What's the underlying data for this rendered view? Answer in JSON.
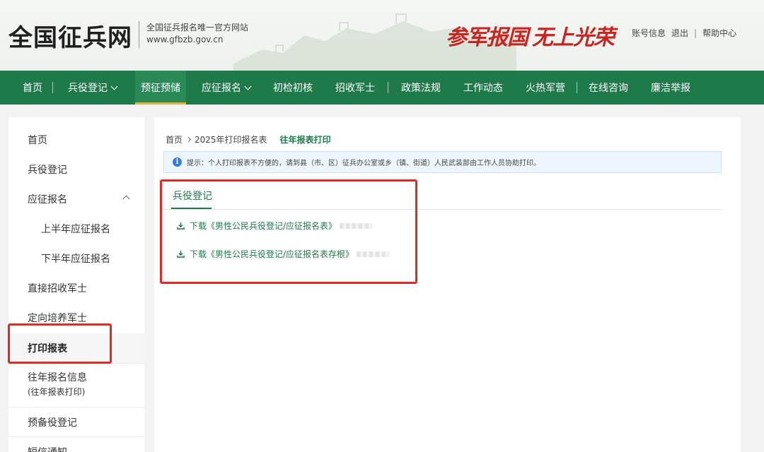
{
  "header": {
    "site_title": "全国征兵网",
    "subtitle": "全国征兵报名唯一官方网站",
    "domain": "www.gfbzb.gov.cn",
    "slogan_1": "参军报国",
    "slogan_2": "无上光荣",
    "links": {
      "account": "账号信息",
      "logout": "退出",
      "sep": "|",
      "help": "帮助中心"
    }
  },
  "nav": {
    "items": [
      {
        "label": "首页"
      },
      {
        "label": "兵役登记"
      },
      {
        "label": "预征预储"
      },
      {
        "label": "应征报名"
      },
      {
        "label": "初检初核"
      },
      {
        "label": "招收军士"
      },
      {
        "label": "政策法规"
      },
      {
        "label": "工作动态"
      },
      {
        "label": "火热军营"
      },
      {
        "label": "在线咨询"
      },
      {
        "label": "廉洁举报"
      }
    ],
    "active": "预征预储"
  },
  "sidebar": {
    "items": [
      {
        "label": "首页"
      },
      {
        "label": "兵役登记"
      },
      {
        "label": "应征报名"
      },
      {
        "label": "上半年应征报名"
      },
      {
        "label": "下半年应征报名"
      },
      {
        "label": "直接招收军士"
      },
      {
        "label": "定向培养军士"
      },
      {
        "label": "打印报表"
      },
      {
        "label": "往年报名信息"
      },
      {
        "label": "(往年报表打印)"
      },
      {
        "label": "预备役登记"
      },
      {
        "label": "短信通知"
      }
    ],
    "active": "打印报表"
  },
  "main": {
    "breadcrumb": {
      "home": "首页",
      "level2": "2025年打印报名表",
      "current": "往年报表打印"
    },
    "tip_icon": "i",
    "tip": "提示：个人打印报表不方便的，请到县（市、区）征兵办公室或乡（镇、街道）人民武装部由工作人员协助打印。",
    "tab_label": "兵役登记",
    "downloads": [
      {
        "label": "下载《男性公民兵役登记/应征报名表》"
      },
      {
        "label": "下载《男性公民兵役登记/应征报名表存根》"
      }
    ]
  },
  "colors": {
    "nav_green": "#1e7a4a",
    "accent_gold": "#e2b33b",
    "slogan_red": "#c9241f",
    "highlight_red": "#e02a24"
  }
}
